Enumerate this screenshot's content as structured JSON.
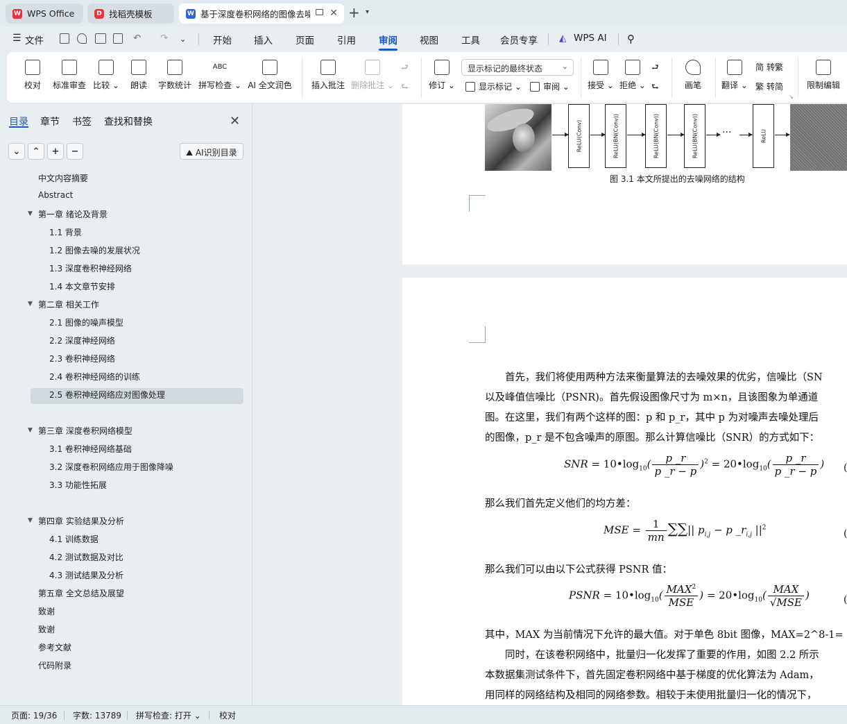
{
  "tabs": [
    {
      "label": "WPS Office",
      "icon": "wps-logo-icon",
      "color": "#e8333a"
    },
    {
      "label": "找稻壳模板",
      "icon": "docer-icon",
      "color": "#e8333a"
    },
    {
      "label": "基于深度卷积网络的图像去噪",
      "icon": "writer-icon",
      "color": "#2b63d9"
    }
  ],
  "menu": {
    "file": "文件",
    "items": [
      "开始",
      "插入",
      "页面",
      "引用",
      "审阅",
      "视图",
      "工具",
      "会员专享"
    ],
    "active": "审阅",
    "ai": "WPS AI"
  },
  "ribbon": {
    "proofread": "校对",
    "std_review": "标准审查",
    "compare": "比较",
    "read_aloud": "朗读",
    "word_count": "字数统计",
    "spell_check": "拼写检查",
    "ai_polish": "AI 全文润色",
    "insert_comment": "插入批注",
    "delete_comment": "删除批注",
    "track_changes": "修订",
    "markup_state": "显示标记的最终状态",
    "show_markup": "显示标记",
    "review": "审阅",
    "accept": "接受",
    "reject": "拒绝",
    "ink": "画笔",
    "translate": "翻译",
    "to_traditional": "转繁",
    "to_simplified": "转简",
    "restrict_edit": "限制编辑"
  },
  "nav": {
    "tabs": [
      "目录",
      "章节",
      "书签",
      "查找和替换"
    ],
    "ai_toc": "AI识别目录",
    "toc": [
      {
        "label": "中文内容摘要",
        "level": 0
      },
      {
        "label": "Abstract",
        "level": 0
      },
      {
        "label": "第一章  绪论及背景",
        "level": 0,
        "expanded": true
      },
      {
        "label": "1.1 背景",
        "level": 1
      },
      {
        "label": "1.2 图像去噪的发展状况",
        "level": 1
      },
      {
        "label": "1.3 深度卷积神经网络",
        "level": 1
      },
      {
        "label": "1.4 本文章节安排",
        "level": 1
      },
      {
        "label": "第二章  相关工作",
        "level": 0,
        "expanded": true
      },
      {
        "label": "2.1 图像的噪声模型",
        "level": 1
      },
      {
        "label": "2.2 深度神经网络",
        "level": 1
      },
      {
        "label": "2.3 卷积神经网络",
        "level": 1
      },
      {
        "label": "2.4 卷积神经网络的训练",
        "level": 1
      },
      {
        "label": "2.5 卷积神经网络应对图像处理",
        "level": 1,
        "selected": true
      },
      {
        "label": "第三章  深度卷积网络模型",
        "level": 0,
        "expanded": true
      },
      {
        "label": "3.1 卷积神经网络基础",
        "level": 1
      },
      {
        "label": "3.2 深度卷积网络应用于图像降噪",
        "level": 1
      },
      {
        "label": "3.3 功能性拓展",
        "level": 1
      },
      {
        "label": "第四章  实验结果及分析",
        "level": 0,
        "expanded": true
      },
      {
        "label": "4.1 训练数据",
        "level": 1
      },
      {
        "label": "4.2 测试数据及对比",
        "level": 1
      },
      {
        "label": "4.3 测试结果及分析",
        "level": 1
      },
      {
        "label": "第五章  全文总结及展望",
        "level": 0
      },
      {
        "label": "致谢",
        "level": 0
      },
      {
        "label": "致谢",
        "level": 0
      },
      {
        "label": "参考文献",
        "level": 0
      },
      {
        "label": "代码附录",
        "level": 0
      }
    ]
  },
  "document": {
    "figure": {
      "layers": [
        "ReLU(Conv)",
        "ReLU(BN(Conv))",
        "ReLU(BN(Conv))",
        "ReLU(BN(Conv))",
        "ReLU"
      ],
      "ellipsis": "···",
      "caption": "图 3.1  本文所提出的去噪网络的结构"
    },
    "paragraphs": [
      "首先，我们将使用两种方法来衡量算法的去噪效果的优劣，信噪比（SN",
      "以及峰值信噪比（PSNR)。首先假设图像尺寸为 m×n，且该图象为单通道",
      "图。在这里，我们有两个这样的图：p 和 p_r，其中 p 为对噪声去噪处理后",
      "的图像，p_r 是不包含噪声的原图。那么计算信噪比（SNR）的方式如下：",
      "那么我们首先定义他们的均方差：",
      "那么我们可以由以下公式获得 PSNR 值：",
      "其中，MAX 为当前情况下允许的最大值。对于单色 8bit 图像，MAX=2^8-1=",
      "同时，在该卷积网络中，批量归一化发挥了重要的作用，如图 2.2 所示",
      "本数据集测试条件下，首先固定卷积网络中基于梯度的优化算法为 Adam，",
      "用同样的网络结构及相同的网络参数。相较于未使用批量归一化的情况下，"
    ],
    "formula_number": "("
  },
  "status": {
    "page": "页面: 19/36",
    "words": "字数: 13789",
    "spell": "拼写检查: 打开",
    "proof": "校对"
  }
}
